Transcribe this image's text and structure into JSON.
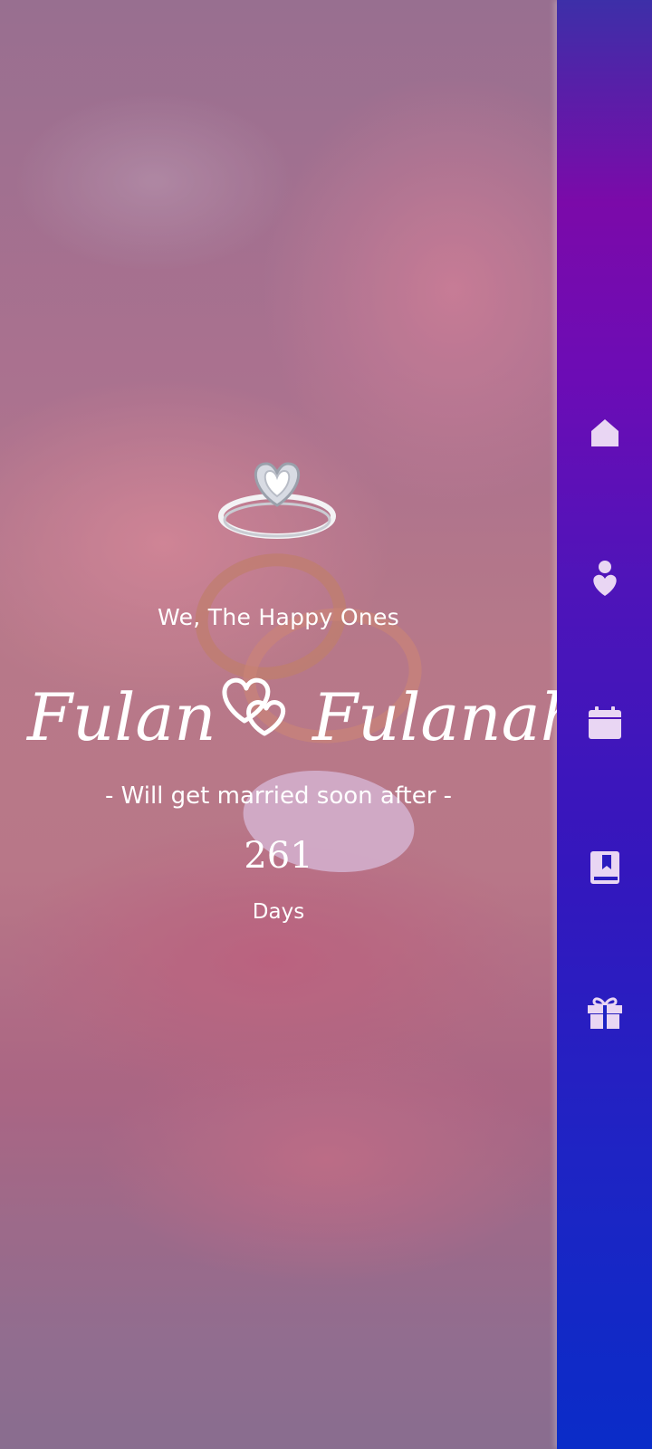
{
  "hero": {
    "subtitle": "We, The Happy Ones",
    "groom": "Fulan",
    "bride": "Fulanah",
    "tagline": "- Will get married soon after -",
    "countdown_value": "261",
    "countdown_unit": "Days"
  },
  "sidebar": {
    "items": [
      {
        "icon": "home-icon"
      },
      {
        "icon": "couple-heart-icon"
      },
      {
        "icon": "calendar-icon"
      },
      {
        "icon": "book-icon"
      },
      {
        "icon": "gift-icon"
      }
    ]
  },
  "colors": {
    "sidebar_top": "#3d2fa8",
    "sidebar_mid": "#7b0aa9",
    "sidebar_bottom": "#0a2cc8",
    "icon": "#e9d6f3",
    "text": "#ffffff"
  }
}
